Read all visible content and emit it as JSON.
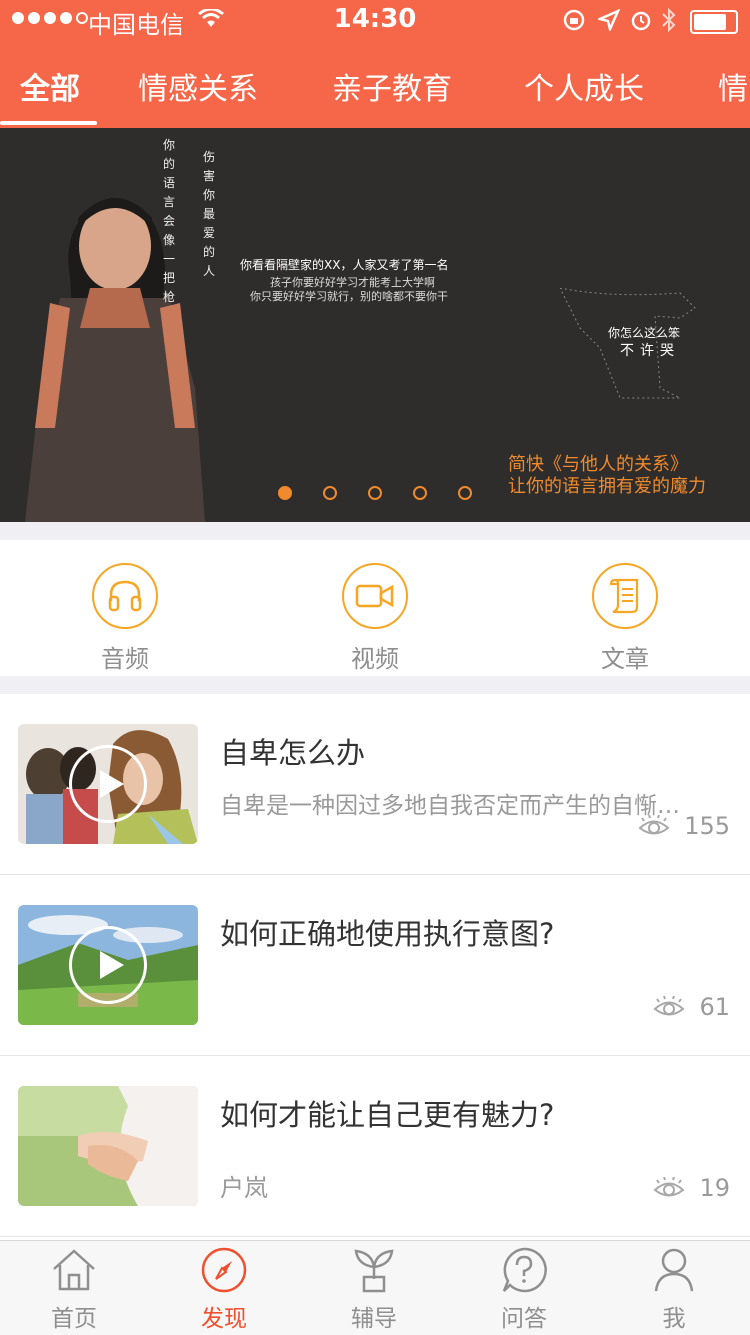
{
  "status_bar": {
    "carrier": "中国电信",
    "time": "14:30"
  },
  "tabs": [
    {
      "label": "全部",
      "active": true
    },
    {
      "label": "情感关系",
      "active": false
    },
    {
      "label": "亲子教育",
      "active": false
    },
    {
      "label": "个人成长",
      "active": false
    },
    {
      "label": "情",
      "active": false
    }
  ],
  "banner": {
    "vertical_text_1": "你的语言会像一把枪",
    "vertical_text_2": "伤害你最爱的人",
    "scatter_text_1": "你看看隔壁家的XX，人家又考了第一名",
    "scatter_text_2": "你怎么这么笨",
    "scatter_text_3": "不许哭",
    "scatter_text_4": "孩子你要好好学习才能考上大学啊",
    "scatter_text_5": "你只要好好学习就行，别的啥都不要你干",
    "caption_line1": "简快《与他人的关系》",
    "caption_line2": "让你的语言拥有爱的魔力",
    "page_count": 5,
    "current_page": 1
  },
  "categories": [
    {
      "label": "音频",
      "icon": "headphones-icon"
    },
    {
      "label": "视频",
      "icon": "video-camera-icon"
    },
    {
      "label": "文章",
      "icon": "scroll-icon"
    }
  ],
  "articles": [
    {
      "title": "自卑怎么办",
      "description": "自卑是一种因过多地自我否定而产生的自惭…",
      "views": "155",
      "has_video": true
    },
    {
      "title": "如何正确地使用执行意图?",
      "views": "61",
      "has_video": true
    },
    {
      "title": "如何才能让自己更有魅力?",
      "author": "户岚",
      "views": "19",
      "has_video": false
    }
  ],
  "bottom_nav": [
    {
      "label": "首页",
      "icon": "home-icon",
      "active": false
    },
    {
      "label": "发现",
      "icon": "compass-icon",
      "active": true
    },
    {
      "label": "辅导",
      "icon": "sprout-icon",
      "active": false
    },
    {
      "label": "问答",
      "icon": "question-icon",
      "active": false
    },
    {
      "label": "我",
      "icon": "person-icon",
      "active": false
    }
  ],
  "colors": {
    "brand": "#f66649",
    "accent_orange": "#f6a623",
    "active_nav": "#f0502e"
  }
}
